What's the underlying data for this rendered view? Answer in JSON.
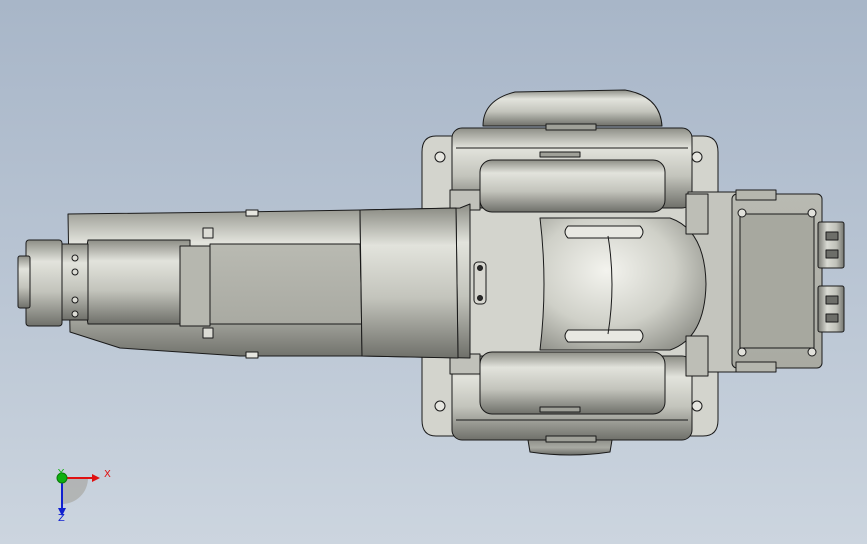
{
  "viewport": {
    "background_top": "#a8b6c8",
    "background_bottom": "#ccd5df"
  },
  "triad": {
    "x_label": "X",
    "y_label": "Y",
    "z_label": "Z",
    "x_color": "#e01010",
    "y_color": "#10b010",
    "z_color": "#1020d0"
  },
  "model": {
    "part_fill": "#c9cac2",
    "edge_color": "#1a1a1a"
  }
}
